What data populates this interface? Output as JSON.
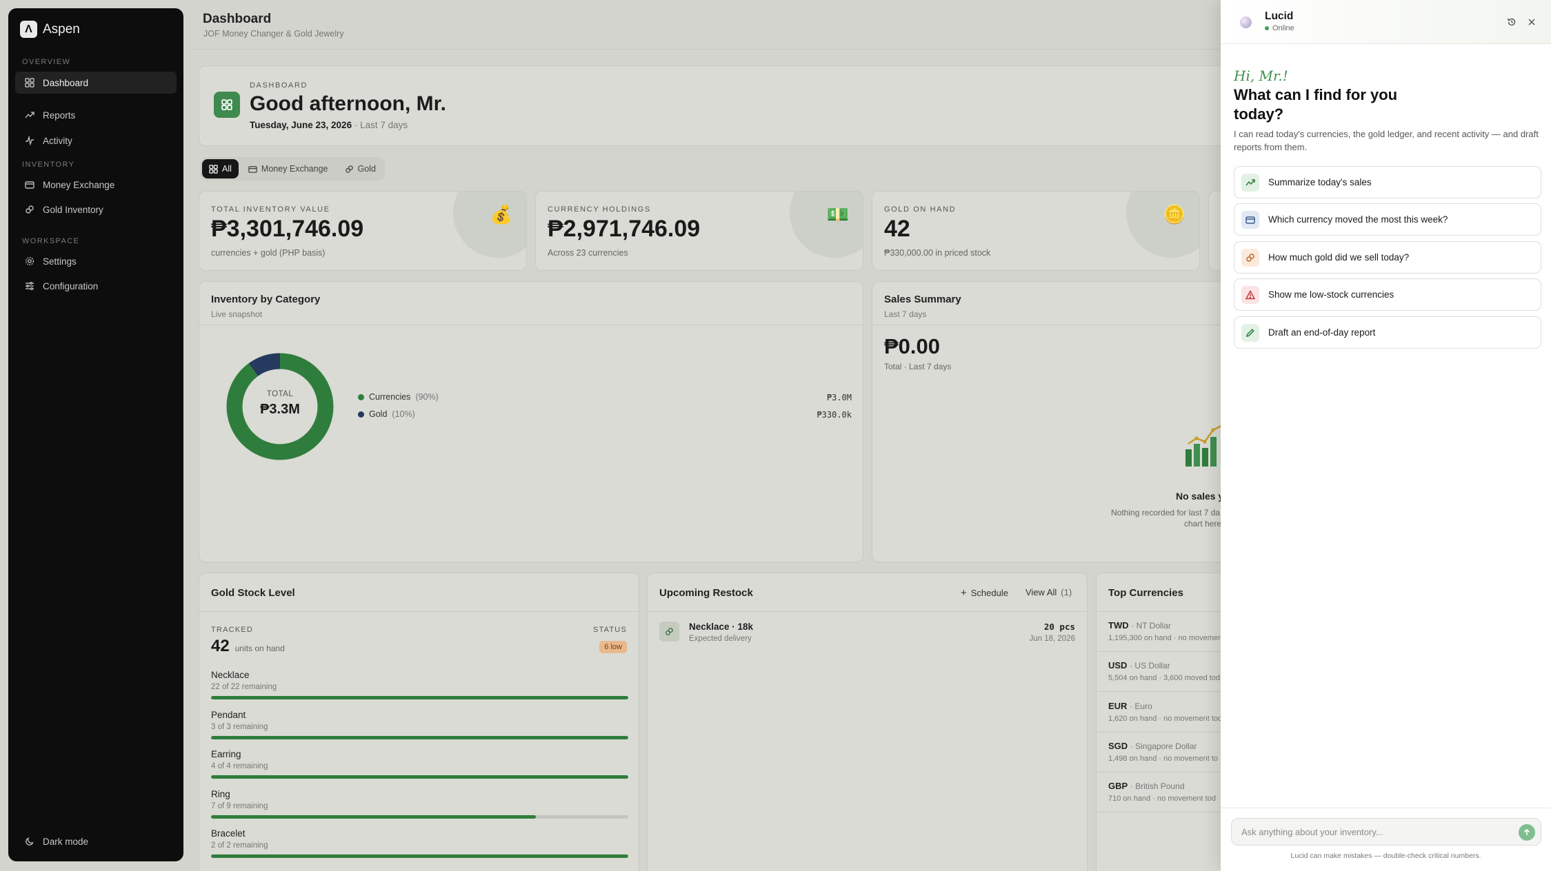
{
  "sidebar": {
    "brand": "Aspen",
    "brand_mark": "Λ",
    "sections": {
      "overview": "OVERVIEW",
      "inventory": "INVENTORY",
      "workspace": "WORKSPACE"
    },
    "items": [
      {
        "label": "Dashboard",
        "icon": "grid-icon"
      },
      {
        "label": "Reports",
        "icon": "trend-icon"
      },
      {
        "label": "Activity",
        "icon": "pulse-icon"
      },
      {
        "label": "Money Exchange",
        "icon": "wallet-icon"
      },
      {
        "label": "Gold Inventory",
        "icon": "link-icon"
      },
      {
        "label": "Settings",
        "icon": "gear-icon"
      },
      {
        "label": "Configuration",
        "icon": "sliders-icon"
      }
    ],
    "dark_mode": "Dark mode"
  },
  "header": {
    "title": "Dashboard",
    "subtitle": "JOF Money Changer & Gold Jewelry"
  },
  "greeting": {
    "eyebrow": "DASHBOARD",
    "title": "Good afternoon, Mr.",
    "date": "Tuesday, June 23, 2026",
    "range": "· Last 7 days"
  },
  "filters": [
    "All",
    "Money Exchange",
    "Gold"
  ],
  "kpis": [
    {
      "label": "TOTAL INVENTORY VALUE",
      "value": "₱3,301,746.09",
      "sub": "currencies + gold (PHP basis)",
      "icon": "money-bag-icon",
      "glyph": "💰"
    },
    {
      "label": "CURRENCY HOLDINGS",
      "value": "₱2,971,746.09",
      "sub": "Across 23 currencies",
      "icon": "cash-icon",
      "glyph": "💵"
    },
    {
      "label": "GOLD ON HAND",
      "value": "42",
      "sub": "₱330,000.00 in priced stock",
      "icon": "gold-bar-icon",
      "glyph": "🪙"
    }
  ],
  "inventory_by_category": {
    "title": "Inventory by Category",
    "subtitle": "Live snapshot",
    "donut_label": "TOTAL",
    "donut_value": "₱3.3M",
    "legend": [
      {
        "name": "Currencies",
        "pct": "(90%)",
        "value": "₱3.0M",
        "color": "#2f7d3c",
        "fraction": 0.9
      },
      {
        "name": "Gold",
        "pct": "(10%)",
        "value": "₱330.0k",
        "color": "#243a5e",
        "fraction": 0.1
      }
    ]
  },
  "sales_summary": {
    "title": "Sales Summary",
    "subtitle": "Last 7 days",
    "value": "₱0.00",
    "caption": "Total · Last 7 days",
    "empty_title": "No sales y",
    "empty_line1": "Nothing recorded for last 7 da",
    "empty_line2": "chart here"
  },
  "gold_stock": {
    "title": "Gold Stock Level",
    "tracked_label": "TRACKED",
    "tracked_value": "42",
    "tracked_unit": "units on hand",
    "status_label": "STATUS",
    "status_badge": "6 low",
    "items": [
      {
        "name": "Necklace",
        "remaining": "22 of 22 remaining",
        "level": 1.0
      },
      {
        "name": "Pendant",
        "remaining": "3 of 3 remaining",
        "level": 1.0
      },
      {
        "name": "Earring",
        "remaining": "4 of 4 remaining",
        "level": 1.0
      },
      {
        "name": "Ring",
        "remaining": "7 of 9 remaining",
        "level": 0.778
      },
      {
        "name": "Bracelet",
        "remaining": "2 of 2 remaining",
        "level": 1.0
      }
    ]
  },
  "restock": {
    "title": "Upcoming Restock",
    "schedule_label": "Schedule",
    "view_all_label": "View All",
    "view_all_count": "(1)",
    "items": [
      {
        "name": "Necklace · 18k",
        "note": "Expected delivery",
        "qty": "20 pcs",
        "date": "Jun 18, 2026"
      }
    ]
  },
  "top_currencies": {
    "title": "Top Currencies",
    "items": [
      {
        "code": "TWD",
        "name": "· NT Dollar",
        "meta": "1,195,300 on hand · no movement"
      },
      {
        "code": "USD",
        "name": "· US Dollar",
        "meta": "5,504 on hand · 3,600 moved tod"
      },
      {
        "code": "EUR",
        "name": "· Euro",
        "meta": "1,620 on hand · no movement tod"
      },
      {
        "code": "SGD",
        "name": "· Singapore Dollar",
        "meta": "1,498 on hand · no movement to"
      },
      {
        "code": "GBP",
        "name": "· British Pound",
        "meta": "710 on hand · no movement tod"
      }
    ]
  },
  "assistant": {
    "name": "Lucid",
    "status": "Online",
    "hi": "Hi, Mr.!",
    "title": "What can I find for you today?",
    "description": "I can read today's currencies, the gold ledger, and recent activity — and draft reports from them.",
    "suggestions": [
      {
        "label": "Summarize today's sales",
        "icon": "trend-icon",
        "bg": "#e3f1e4",
        "fg": "#2f7d3c"
      },
      {
        "label": "Which currency moved the most this week?",
        "icon": "wallet-icon",
        "bg": "#e2e9f5",
        "fg": "#3b5b8f"
      },
      {
        "label": "How much gold did we sell today?",
        "icon": "link-icon",
        "bg": "#fbe9dc",
        "fg": "#c0652a"
      },
      {
        "label": "Show me low-stock currencies",
        "icon": "alert-icon",
        "bg": "#fbe4e4",
        "fg": "#c23b3b"
      },
      {
        "label": "Draft an end-of-day report",
        "icon": "pencil-icon",
        "bg": "#e3f1e4",
        "fg": "#2f7d3c"
      }
    ],
    "input_placeholder": "Ask anything about your inventory...",
    "disclaimer": "Lucid can make mistakes — double-check critical numbers."
  }
}
